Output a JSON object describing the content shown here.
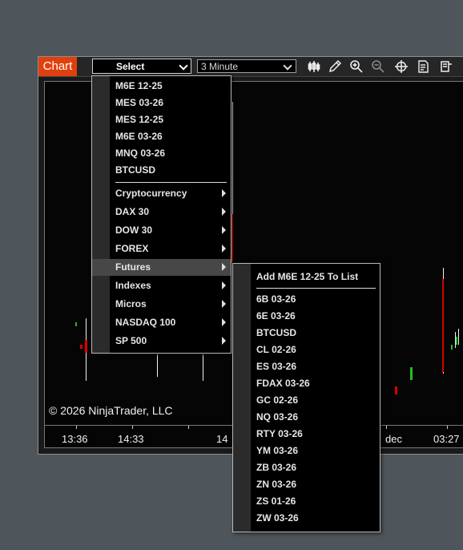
{
  "toolbar": {
    "chart_tab": "Chart",
    "instrument_select": "Select",
    "interval_select": "3 Minute",
    "tools": [
      "bar-style-icon",
      "pencil-draw-icon",
      "zoom-in-icon",
      "zoom-out-icon",
      "crosshair-icon",
      "data-box-icon",
      "properties-icon"
    ]
  },
  "chart": {
    "copyright": "© 2026 NinjaTrader, LLC",
    "x_labels": [
      "13:36",
      "14:33",
      "14",
      "dec",
      "03:27"
    ]
  },
  "instrument_menu": {
    "recent": [
      "M6E 12-25",
      "MES 03-26",
      "MES 12-25",
      "M6E 03-26",
      "MNQ 03-26",
      "BTCUSD"
    ],
    "categories": [
      "Cryptocurrency",
      "DAX 30",
      "DOW 30",
      "FOREX",
      "Futures",
      "Indexes",
      "Micros",
      "NASDAQ 100",
      "SP 500"
    ],
    "highlighted": "Futures"
  },
  "futures_submenu": {
    "add_item": "Add M6E 12-25 To List",
    "items": [
      "6B 03-26",
      "6E 03-26",
      "BTCUSD",
      "CL 02-26",
      "ES 03-26",
      "FDAX 03-26",
      "GC 02-26",
      "NQ 03-26",
      "RTY 03-26",
      "YM 03-26",
      "ZB 03-26",
      "ZN 03-26",
      "ZS 01-26",
      "ZW 03-26"
    ]
  },
  "colors": {
    "background": "#4e555b",
    "chart_tab": "#e0400e",
    "candle_up": "#1fc01f",
    "candle_down": "#d80000"
  }
}
